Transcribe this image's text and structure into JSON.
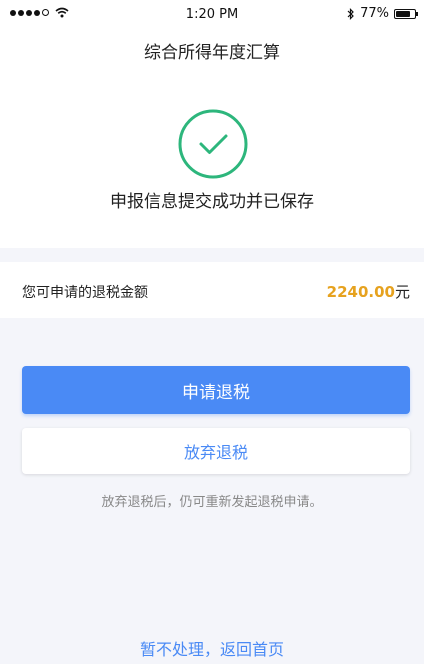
{
  "status_bar": {
    "time": "1:20 PM",
    "battery": "77%",
    "battery_level": 0.77,
    "signal_bars_filled": 4,
    "signal_bars_total": 5,
    "icons": [
      "signal-dots-icon",
      "wifi-icon",
      "bluetooth-icon",
      "battery-icon"
    ]
  },
  "header": {
    "title": "综合所得年度汇算"
  },
  "result": {
    "icon": "check-circle-icon",
    "message": "申报信息提交成功并已保存",
    "accent_color": "#2db67c"
  },
  "refund": {
    "label": "您可申请的退税金额",
    "amount": "2240.00",
    "unit": "元",
    "amount_color": "#e6a21f"
  },
  "actions": {
    "apply_label": "申请退税",
    "abandon_label": "放弃退税",
    "hint": "放弃退税后，仍可重新发起退税申请。",
    "primary_color": "#4a8af5"
  },
  "footer": {
    "link_label": "暂不处理，返回首页"
  }
}
